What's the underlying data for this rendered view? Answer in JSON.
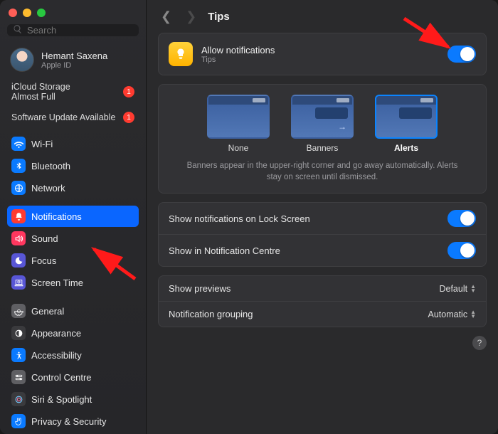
{
  "search": {
    "placeholder": "Search"
  },
  "user": {
    "name": "Hemant Saxena",
    "sub": "Apple ID"
  },
  "alerts": {
    "storage": {
      "line1": "iCloud Storage",
      "line2": "Almost Full",
      "badge": "1"
    },
    "update": {
      "label": "Software Update Available",
      "badge": "1"
    }
  },
  "sidebar": {
    "items": [
      {
        "label": "Wi-Fi"
      },
      {
        "label": "Bluetooth"
      },
      {
        "label": "Network"
      },
      {
        "label": "Notifications"
      },
      {
        "label": "Sound"
      },
      {
        "label": "Focus"
      },
      {
        "label": "Screen Time"
      },
      {
        "label": "General"
      },
      {
        "label": "Appearance"
      },
      {
        "label": "Accessibility"
      },
      {
        "label": "Control Centre"
      },
      {
        "label": "Siri & Spotlight"
      },
      {
        "label": "Privacy & Security"
      }
    ]
  },
  "header": {
    "title": "Tips"
  },
  "app": {
    "title": "Allow notifications",
    "subtitle": "Tips",
    "toggle_on": true
  },
  "styles": {
    "none": "None",
    "banners": "Banners",
    "alerts": "Alerts",
    "desc": "Banners appear in the upper-right corner and go away automatically. Alerts stay on screen until dismissed."
  },
  "options": {
    "lockscreen": {
      "label": "Show notifications on Lock Screen",
      "on": true
    },
    "centre": {
      "label": "Show in Notification Centre",
      "on": true
    },
    "previews": {
      "label": "Show previews",
      "value": "Default"
    },
    "grouping": {
      "label": "Notification grouping",
      "value": "Automatic"
    }
  },
  "help": "?"
}
